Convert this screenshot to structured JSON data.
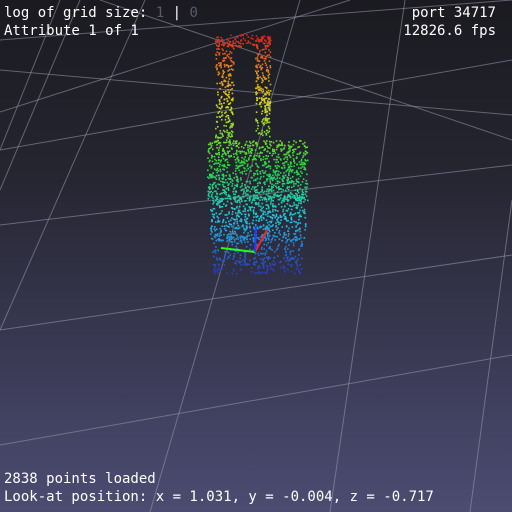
{
  "hud": {
    "grid_size_label": "log of grid size:",
    "grid_size_value": "1",
    "grid_separator": "|",
    "grid_size_current": "0",
    "attribute": "Attribute 1 of 1",
    "port": "port 34717",
    "fps": "12826.6 fps",
    "points_loaded": "2838 points loaded",
    "look_at": "Look-at position: x = 1.031, y = -0.004, z = -0.717"
  },
  "colors": {
    "background_top": "#1a1a20",
    "background_bottom": "#4c4c72",
    "grid": "#9a9ab0",
    "axis_x": "#ff2020",
    "axis_y": "#20ff20",
    "axis_z": "#2040ff"
  },
  "point_cloud": {
    "count": 2838,
    "colormap": "height (blue-cyan-green-yellow-red)"
  }
}
